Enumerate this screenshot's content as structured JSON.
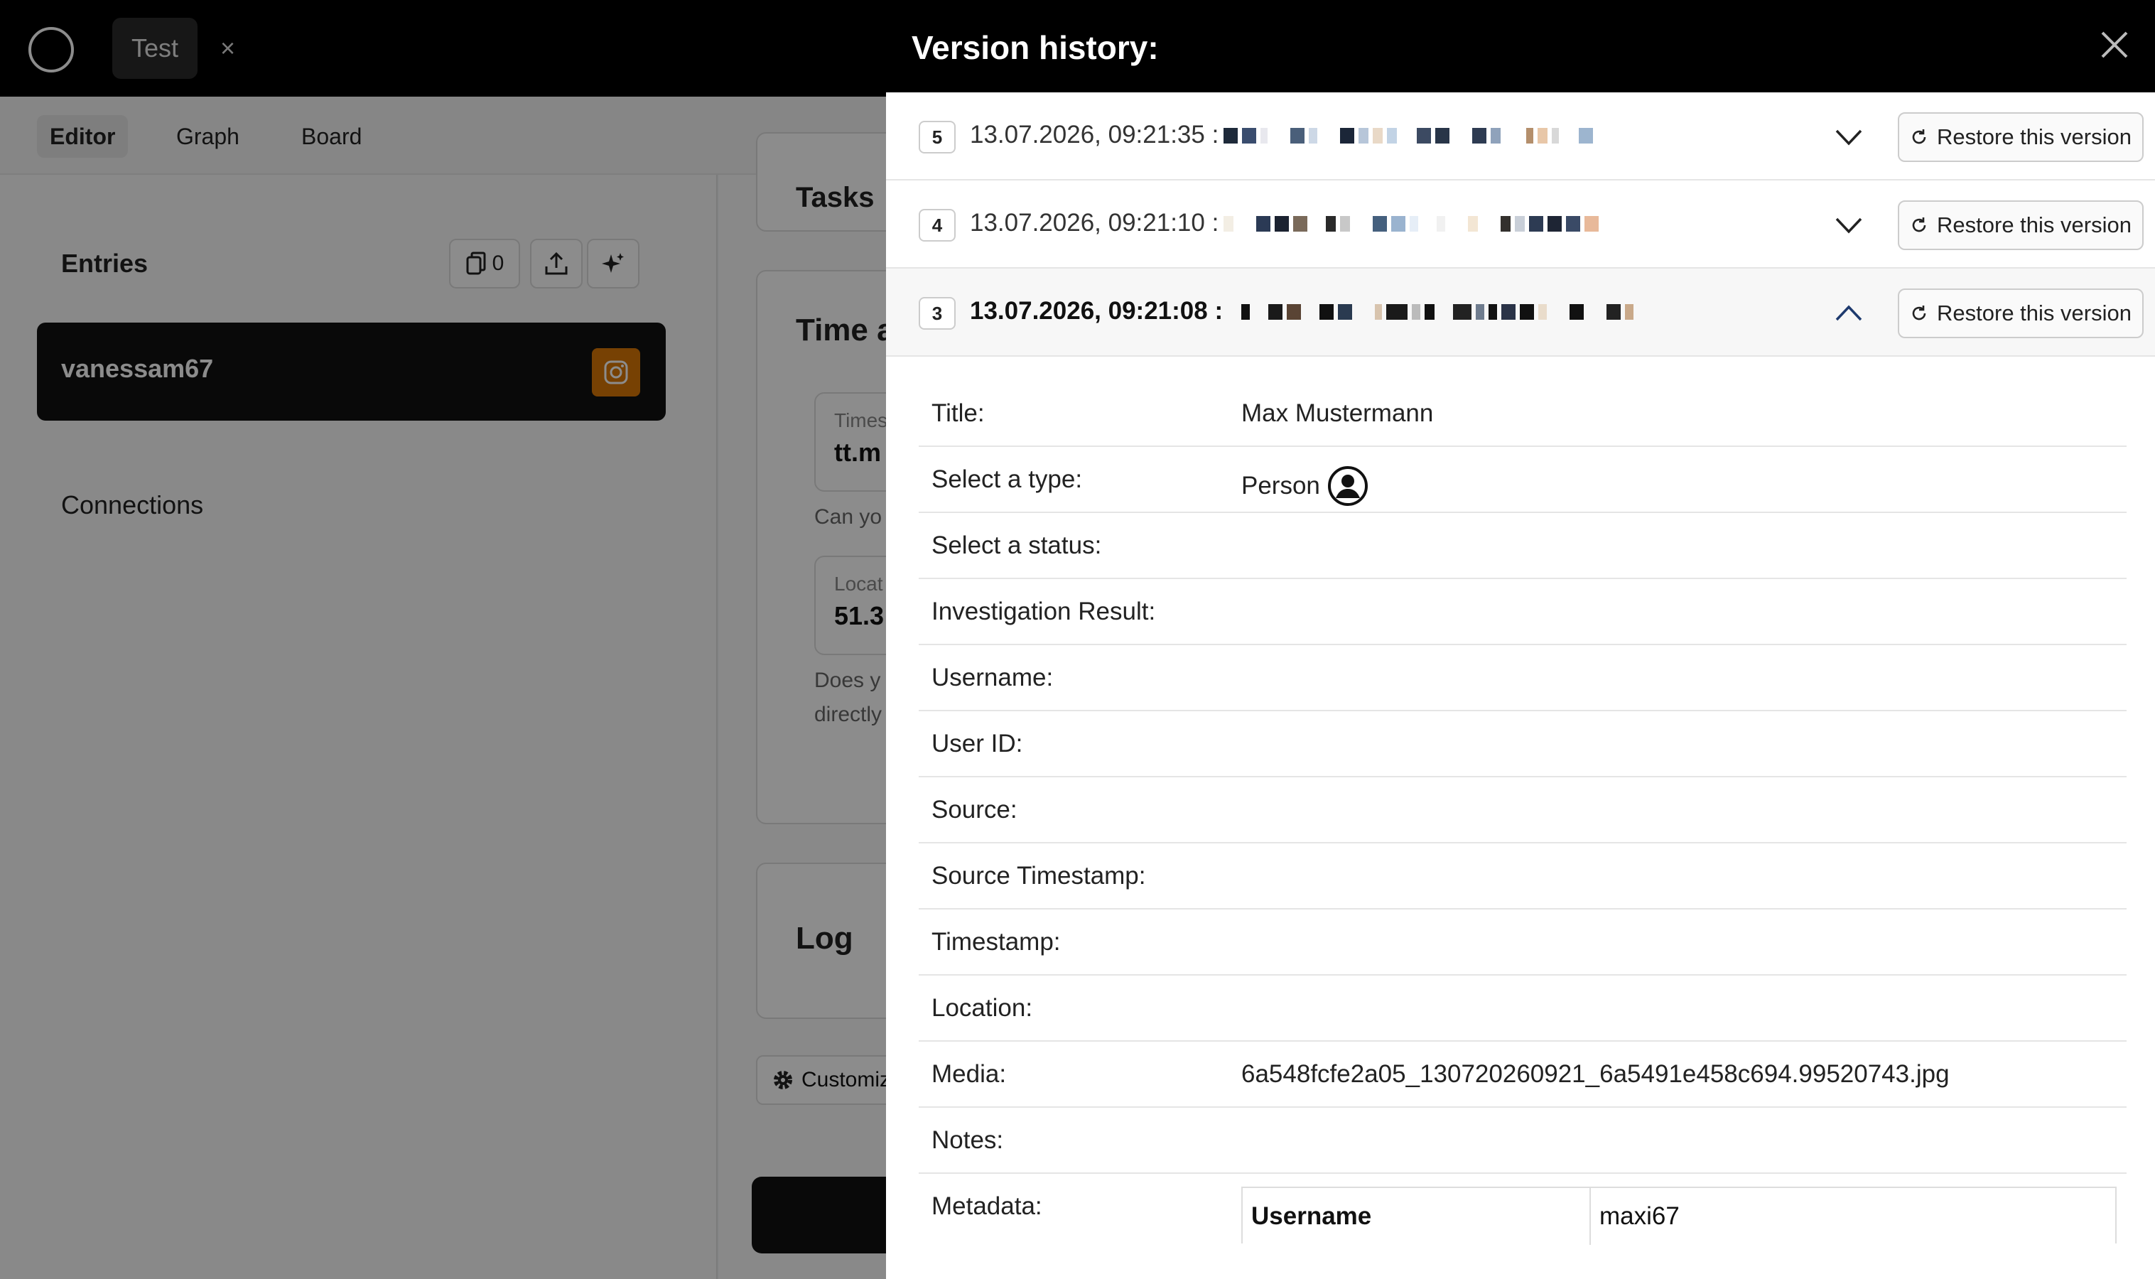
{
  "app": {
    "tab_label": "Test",
    "tab_close": "×",
    "nav": {
      "editor": "Editor",
      "graph": "Graph",
      "board": "Board"
    }
  },
  "entries": {
    "title": "Entries",
    "copy_count": "0",
    "entry_name": "vanessam67",
    "connections_label": "Connections"
  },
  "main": {
    "tasks_title": "Tasks",
    "time_title": "Time a",
    "field1_label": "Times",
    "field1_value": "tt.m",
    "help1": "Can yo",
    "field2_label": "Locat",
    "field2_value": "51.3",
    "help2_line1": "Does y",
    "help2_line2": "directly",
    "log_title": "Log",
    "customize_label": "Customiz"
  },
  "drawer": {
    "title": "Version history:",
    "restore_label": "Restore this version",
    "versions": [
      {
        "number": "5",
        "date": "13.07.2026, 09:21:35 :"
      },
      {
        "number": "4",
        "date": "13.07.2026, 09:21:10 :"
      },
      {
        "number": "3",
        "date": "13.07.2026, 09:21:08 :"
      }
    ],
    "details": {
      "title_label": "Title:",
      "title_value": "Max Mustermann",
      "type_label": "Select a type:",
      "type_value": "Person",
      "status_label": "Select a status:",
      "investigation_label": "Investigation Result:",
      "username_label": "Username:",
      "userid_label": "User ID:",
      "source_label": "Source:",
      "source_ts_label": "Source Timestamp:",
      "timestamp_label": "Timestamp:",
      "location_label": "Location:",
      "media_label": "Media:",
      "media_value": "6a548fcfe2a05_130720260921_6a5491e458c694.99520743.jpg",
      "notes_label": "Notes:",
      "metadata_label": "Metadata:",
      "metadata_key": "Username",
      "metadata_value": "maxi67"
    }
  },
  "colors": {
    "accent_orange": "#d97706",
    "header_black": "#000000",
    "overlay": "rgba(0,0,0,0.45)"
  }
}
